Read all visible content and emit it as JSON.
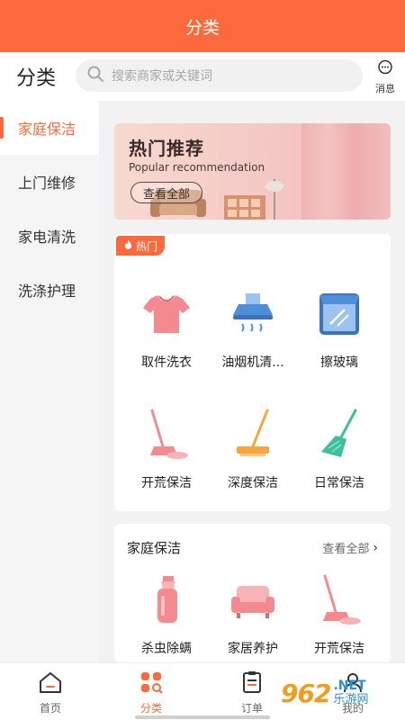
{
  "topbar": {
    "title": "分类"
  },
  "header": {
    "title": "分类",
    "search_placeholder": "搜索商家或关键词",
    "message_label": "消息"
  },
  "sidebar": {
    "items": [
      {
        "label": "家庭保洁",
        "active": true
      },
      {
        "label": "上门维修",
        "active": false
      },
      {
        "label": "家电清洗",
        "active": false
      },
      {
        "label": "洗涤护理",
        "active": false
      }
    ]
  },
  "banner": {
    "title": "热门推荐",
    "subtitle": "Popular recommendation",
    "button": "查看全部"
  },
  "hot": {
    "tag": "热门",
    "items": [
      {
        "label": "取件洗衣",
        "icon": "shirt-icon"
      },
      {
        "label": "油烟机清...",
        "icon": "range-hood-icon"
      },
      {
        "label": "擦玻璃",
        "icon": "window-icon"
      },
      {
        "label": "开荒保洁",
        "icon": "mop-icon"
      },
      {
        "label": "深度保洁",
        "icon": "floor-mop-icon"
      },
      {
        "label": "日常保洁",
        "icon": "broom-icon"
      }
    ]
  },
  "section": {
    "title": "家庭保洁",
    "more": "查看全部",
    "items": [
      {
        "label": "杀虫除螨",
        "icon": "spray-bottle-icon"
      },
      {
        "label": "家居养护",
        "icon": "sofa-icon"
      },
      {
        "label": "开荒保洁",
        "icon": "mop-icon"
      }
    ]
  },
  "tabs": [
    {
      "label": "首页",
      "icon": "home-icon",
      "active": false
    },
    {
      "label": "分类",
      "icon": "category-icon",
      "active": true
    },
    {
      "label": "订单",
      "icon": "order-icon",
      "active": false
    },
    {
      "label": "我的",
      "icon": "user-icon",
      "active": false
    }
  ],
  "watermark": {
    "number": "962",
    "net": ".NET",
    "cn": "乐游网"
  },
  "colors": {
    "accent": "#fb6a3c",
    "pink": "#f48a8f",
    "blue": "#4f8fd8",
    "green": "#3cbf9c",
    "orange": "#f6a640"
  }
}
